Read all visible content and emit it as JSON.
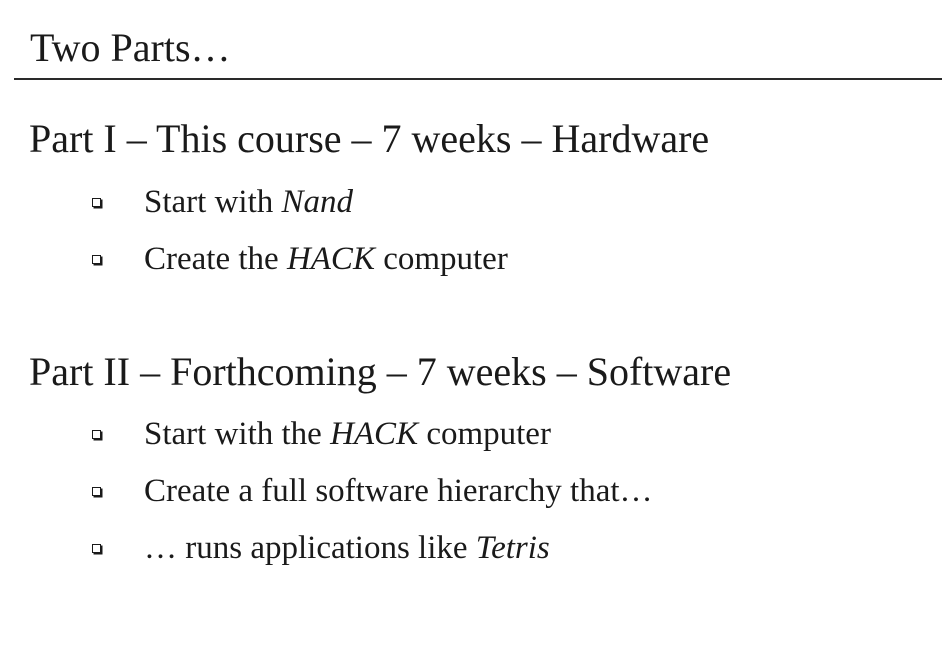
{
  "title": "Two Parts…",
  "sections": [
    {
      "heading": "Part I – This course – 7 weeks – Hardware",
      "bullets": [
        {
          "pre": "Start with ",
          "em": "Nand",
          "post": ""
        },
        {
          "pre": "Create the ",
          "em": "HACK",
          "post": " computer"
        }
      ]
    },
    {
      "heading": "Part II – Forthcoming – 7 weeks – Software",
      "bullets": [
        {
          "pre": "Start with the ",
          "em": "HACK",
          "post": " computer"
        },
        {
          "pre": "Create a full software hierarchy that…",
          "em": "",
          "post": ""
        },
        {
          "pre": "… runs applications like ",
          "em": "Tetris",
          "post": ""
        }
      ]
    }
  ],
  "icons": {
    "bullet": "hollow-square-bullet-icon"
  }
}
